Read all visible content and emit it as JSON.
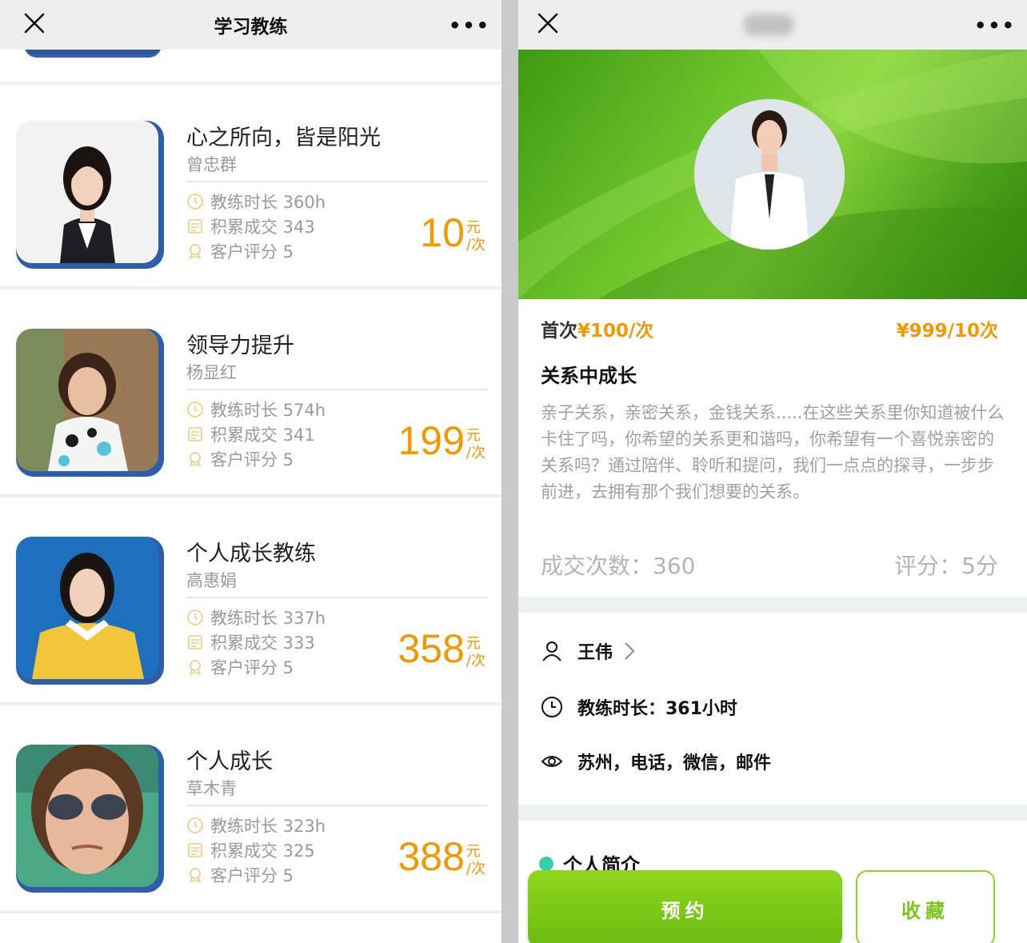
{
  "left_panel": {
    "header": {
      "title": "学习教练",
      "close_icon": "close-icon",
      "more_icon": "more-icon"
    },
    "coaches": [
      {
        "title": "心之所向，皆是阳光",
        "name": "曾忠群",
        "stats": [
          "教练时长 360h",
          "积累成交 343",
          "客户评分 5"
        ],
        "price": "10",
        "unit_top": "元",
        "unit_bottom": "/次"
      },
      {
        "title": "领导力提升",
        "name": "杨显红",
        "stats": [
          "教练时长 574h",
          "积累成交 341",
          "客户评分 5"
        ],
        "price": "199",
        "unit_top": "元",
        "unit_bottom": "/次"
      },
      {
        "title": "个人成长教练",
        "name": "高惠娟",
        "stats": [
          "教练时长 337h",
          "积累成交 333",
          "客户评分 5"
        ],
        "price": "358",
        "unit_top": "元",
        "unit_bottom": "/次"
      },
      {
        "title": "个人成长",
        "name": "草木青",
        "stats": [
          "教练时长 323h",
          "积累成交 325",
          "客户评分 5"
        ],
        "price": "388",
        "unit_top": "元",
        "unit_bottom": "/次"
      }
    ]
  },
  "right_panel": {
    "header": {
      "close_icon": "close-icon",
      "more_icon": "more-icon"
    },
    "first_price_label": "首次",
    "first_price": "¥100/次",
    "pack_price": "¥999/10次",
    "program_title": "关系中成长",
    "description": "亲子关系，亲密关系，金钱关系.....在这些关系里你知道被什么卡住了吗，你希望的关系更和谐吗，你希望有一个喜悦亲密的关系吗？通过陪伴、聆听和提问，我们一点点的探寻，一步步前进，去拥有那个我们想要的关系。",
    "deal_count": "成交次数：360",
    "rating": "评分：5分",
    "coach_name": "王伟",
    "coach_hours": "教练时长：361小时",
    "location": "苏州，电话，微信，邮件",
    "intro_heading": "个人简介",
    "book_button": "预约",
    "favorite_button": "收藏"
  },
  "colors": {
    "accent_orange": "#f39800",
    "accent_green": "#8fd61e"
  }
}
